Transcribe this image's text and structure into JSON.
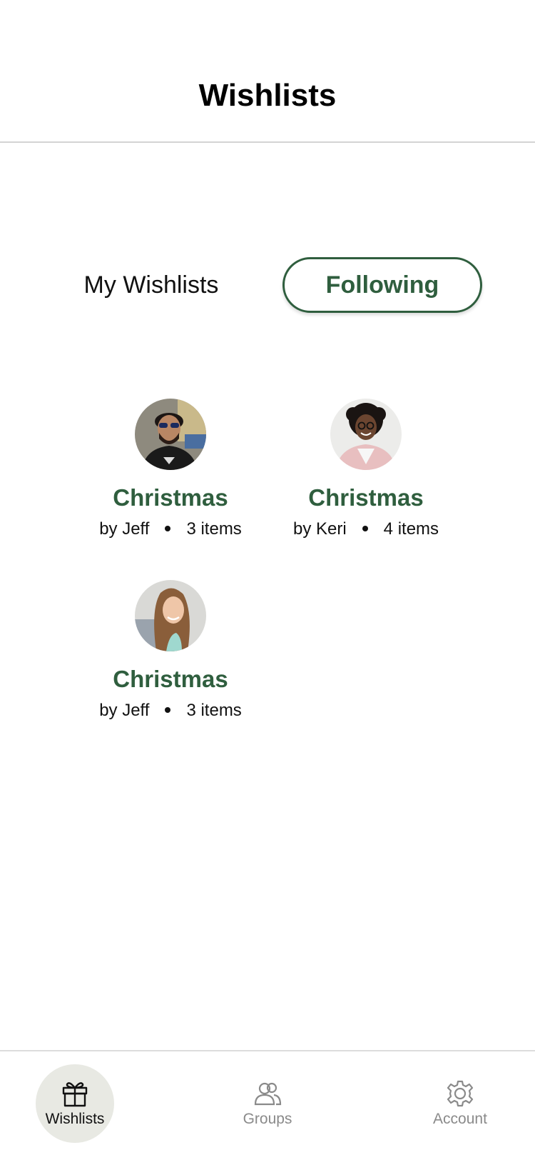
{
  "header": {
    "title": "Wishlists"
  },
  "tabs": {
    "my_label": "My Wishlists",
    "following_label": "Following",
    "active": "Following"
  },
  "lists": [
    {
      "title": "Christmas",
      "owner": "by Jeff",
      "count": "3 items",
      "avatar": "man-with-sunglasses-avatar"
    },
    {
      "title": "Christmas",
      "owner": "by Keri",
      "count": "4 items",
      "avatar": "woman-with-glasses-avatar"
    },
    {
      "title": "Christmas",
      "owner": "by Jeff",
      "count": "3 items",
      "avatar": "woman-long-hair-avatar"
    }
  ],
  "nav": {
    "wishlists_label": "Wishlists",
    "groups_label": "Groups",
    "account_label": "Account",
    "active": "Wishlists"
  },
  "colors": {
    "accent": "#2f5e3e",
    "nav_active_bg": "#e8e9e3",
    "nav_inactive": "#8a8a8a"
  }
}
